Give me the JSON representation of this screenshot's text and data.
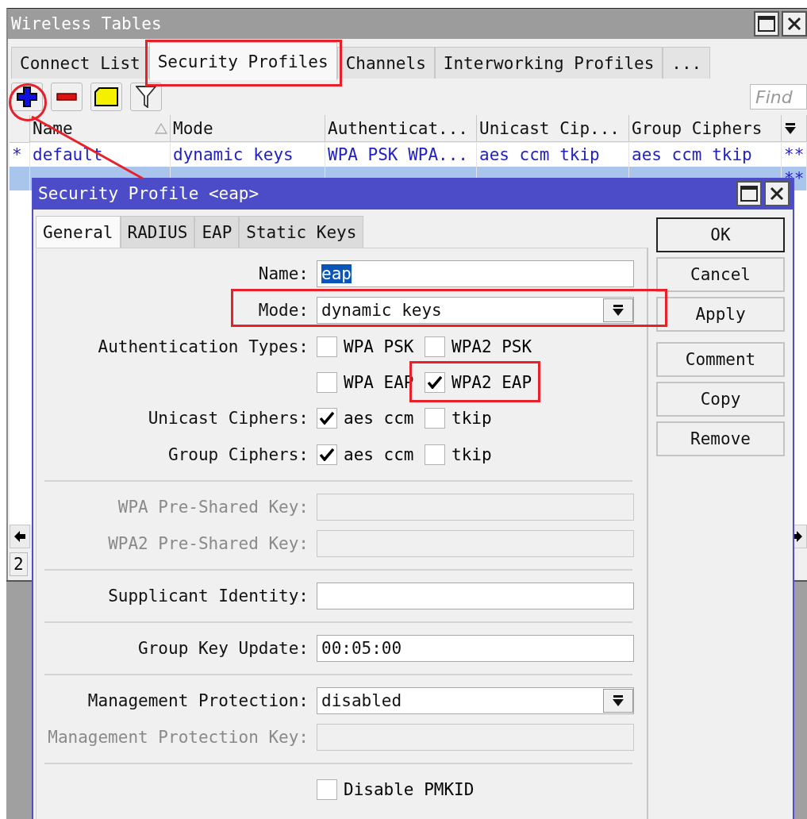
{
  "window": {
    "title": "Wireless Tables"
  },
  "tabs": [
    {
      "label": "Connect List",
      "selected": false
    },
    {
      "label": "Security Profiles",
      "selected": true
    },
    {
      "label": "Channels",
      "selected": false
    },
    {
      "label": "Interworking Profiles",
      "selected": false
    },
    {
      "label": "...",
      "selected": false
    }
  ],
  "find": {
    "placeholder": "Find"
  },
  "table": {
    "columns": [
      {
        "label": "Name",
        "sorted": true
      },
      {
        "label": "Mode",
        "sorted": false
      },
      {
        "label": "Authenticat...",
        "sorted": false
      },
      {
        "label": "Unicast Cip...",
        "sorted": false
      },
      {
        "label": "Group Ciphers",
        "sorted": false
      }
    ],
    "rows": [
      {
        "selected": false,
        "flag": "*",
        "cells": [
          "default",
          "dynamic keys",
          "WPA PSK WPA...",
          "aes ccm tkip",
          "aes ccm tkip"
        ],
        "column_7": "**"
      },
      {
        "selected": true,
        "column_7": "**"
      }
    ]
  },
  "status_bar": {
    "count": "2"
  },
  "dialog": {
    "title": "Security Profile <eap>",
    "tabs": [
      {
        "label": "General",
        "selected": true
      },
      {
        "label": "RADIUS",
        "selected": false
      },
      {
        "label": "EAP",
        "selected": false
      },
      {
        "label": "Static Keys",
        "selected": false
      }
    ],
    "button_groups": [
      [
        {
          "label": "OK",
          "default": true
        },
        {
          "label": "Cancel",
          "default": false
        },
        {
          "label": "Apply",
          "default": false
        }
      ],
      [
        {
          "label": "Comment",
          "default": false
        },
        {
          "label": "Copy",
          "default": false
        },
        {
          "label": "Remove",
          "default": false
        }
      ]
    ],
    "sections": [
      [
        {
          "kind": "text",
          "label": "Name:",
          "value": "eap",
          "highlighted": true,
          "disabled": false
        },
        {
          "kind": "select",
          "label": "Mode:",
          "value": "dynamic keys"
        },
        {
          "kind": "checkboxes",
          "label": "Authentication Types:",
          "lines": [
            [
              {
                "label": "WPA PSK",
                "checked": false
              },
              {
                "label": "WPA2 PSK",
                "checked": false
              }
            ],
            [
              {
                "label": "WPA EAP",
                "checked": false
              },
              {
                "label": "WPA2 EAP",
                "checked": true
              }
            ]
          ]
        },
        {
          "kind": "checkboxes",
          "label": "Unicast Ciphers:",
          "lines": [
            [
              {
                "label": "aes ccm",
                "checked": true
              },
              {
                "label": "tkip",
                "checked": false
              }
            ]
          ]
        },
        {
          "kind": "checkboxes",
          "label": "Group Ciphers:",
          "lines": [
            [
              {
                "label": "aes ccm",
                "checked": true
              },
              {
                "label": "tkip",
                "checked": false
              }
            ]
          ]
        }
      ],
      [
        {
          "kind": "text",
          "label": "WPA Pre-Shared Key:",
          "disabled": true
        },
        {
          "kind": "text",
          "label": "WPA2 Pre-Shared Key:",
          "disabled": true
        }
      ],
      [
        {
          "kind": "text",
          "label": "Supplicant Identity:",
          "disabled": false
        }
      ],
      [
        {
          "kind": "text",
          "label": "Group Key Update:",
          "value": "00:05:00",
          "highlighted": false,
          "disabled": false
        }
      ],
      [
        {
          "kind": "select",
          "label": "Management Protection:",
          "value": "disabled"
        },
        {
          "kind": "text",
          "label": "Management Protection Key:",
          "disabled": true
        }
      ],
      [
        {
          "kind": "checkbox",
          "label": "Disable PMKID",
          "checked": false
        }
      ]
    ]
  }
}
